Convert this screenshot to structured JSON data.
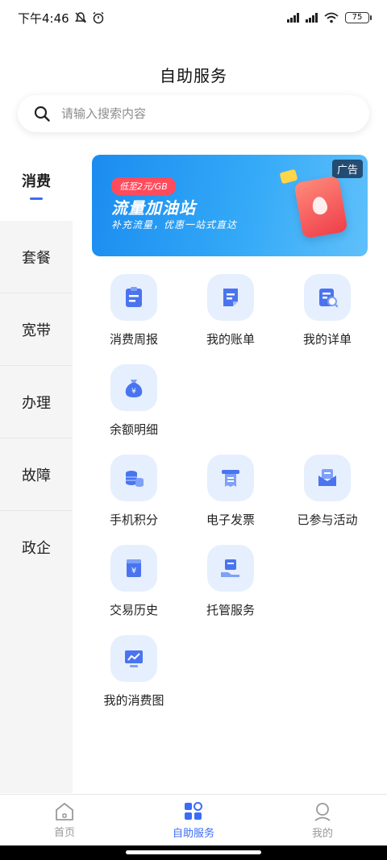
{
  "status_bar": {
    "time": "下午4:46",
    "battery": "75"
  },
  "page_title": "自助服务",
  "search": {
    "placeholder": "请输入搜索内容"
  },
  "sidebar": {
    "items": [
      {
        "label": "消费",
        "active": true
      },
      {
        "label": "套餐"
      },
      {
        "label": "宽带"
      },
      {
        "label": "办理"
      },
      {
        "label": "故障"
      },
      {
        "label": "政企"
      }
    ]
  },
  "banner": {
    "ad_tag": "广告",
    "price_pill": "低至2元/GB",
    "title": "流量加油站",
    "subtitle": "补充流量，优惠一站式直达"
  },
  "services": {
    "row1": [
      "消费周报",
      "我的账单",
      "我的详单"
    ],
    "row2": [
      "余额明细"
    ],
    "row3": [
      "手机积分",
      "电子发票",
      "已参与活动"
    ],
    "row4": [
      "交易历史",
      "托管服务"
    ],
    "row5": [
      "我的消费图"
    ]
  },
  "tabbar": {
    "home": "首页",
    "self_service": "自助服务",
    "mine": "我的"
  },
  "colors": {
    "accent": "#3b6cf6",
    "icon_bg": "#e6effd"
  }
}
